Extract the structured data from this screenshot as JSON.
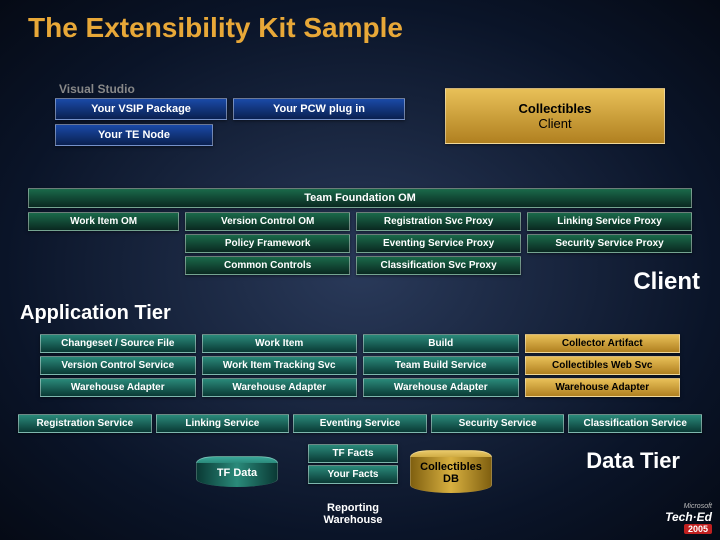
{
  "title": "The Extensibility Kit Sample",
  "vs": {
    "label": "Visual Studio",
    "vsip": "Your VSIP Package",
    "pcw": "Your PCW plug in",
    "te": "Your TE Node"
  },
  "collectibles_client_l1": "Collectibles",
  "collectibles_client_l2": "Client",
  "tfom": "Team Foundation OM",
  "om": {
    "r1": [
      "Work Item OM",
      "Version Control OM",
      "Registration Svc Proxy",
      "Linking Service Proxy"
    ],
    "r2": [
      "",
      "Policy Framework",
      "Eventing Service Proxy",
      "Security Service Proxy"
    ],
    "r3": [
      "",
      "Common Controls",
      "Classification Svc Proxy",
      ""
    ]
  },
  "client_tag": "Client",
  "apptier_label": "Application Tier",
  "app": {
    "r1": [
      "Changeset / Source File",
      "Work Item",
      "Build",
      "Collector Artifact"
    ],
    "r2": [
      "Version Control Service",
      "Work Item Tracking Svc",
      "Team Build Service",
      "Collectibles Web Svc"
    ],
    "r3": [
      "Warehouse Adapter",
      "Warehouse Adapter",
      "Warehouse Adapter",
      "Warehouse Adapter"
    ]
  },
  "svc": [
    "Registration Service",
    "Linking Service",
    "Eventing Service",
    "Security Service",
    "Classification Service"
  ],
  "datatier_label": "Data Tier",
  "cyl": {
    "tfdata": "TF Data",
    "tffacts": "TF Facts",
    "yourfacts": "Your Facts",
    "collectdb_l1": "Collectibles",
    "collectdb_l2": "DB"
  },
  "rw": "Reporting Warehouse",
  "logo": {
    "ms": "Microsoft",
    "brand": "Tech·Ed",
    "year": "2005"
  }
}
